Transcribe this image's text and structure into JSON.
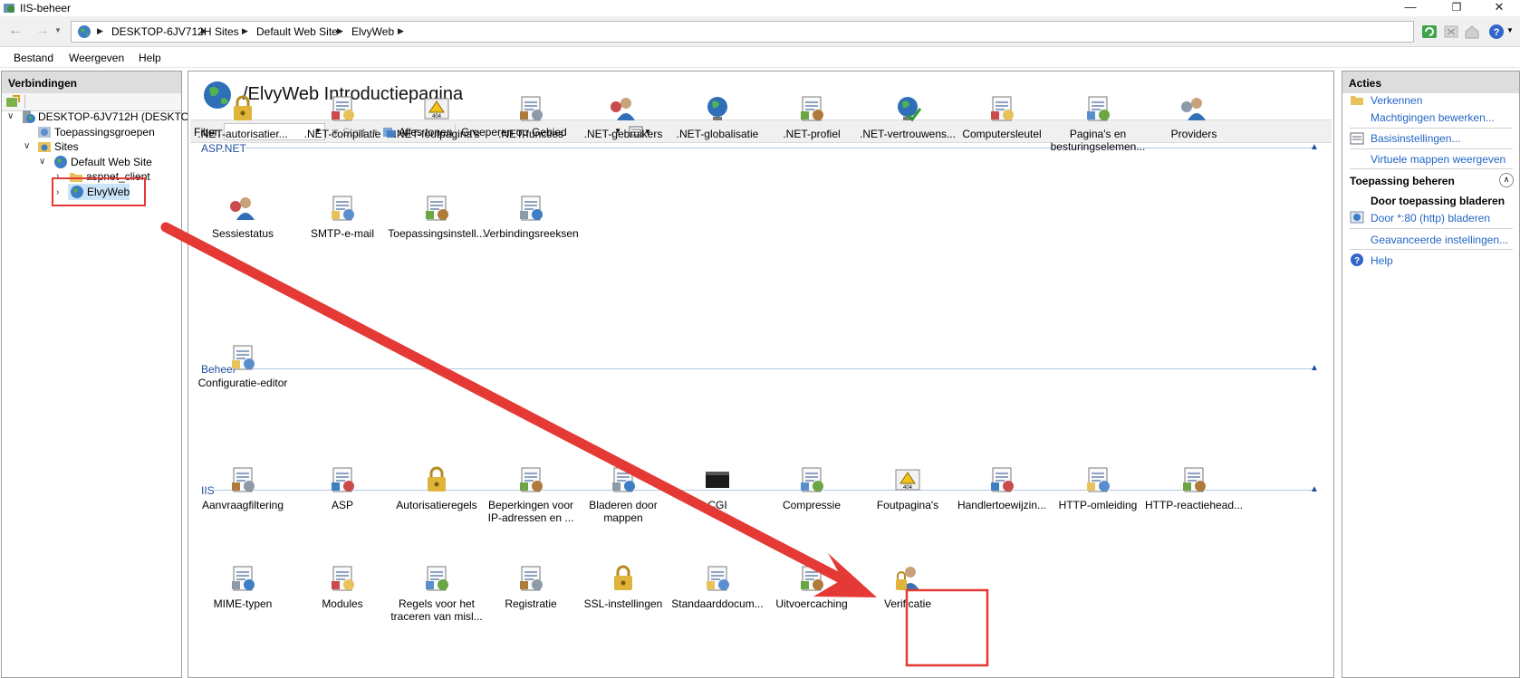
{
  "window": {
    "title": "IIS-beheer",
    "min_glyph": "—",
    "restore_glyph": "❐",
    "close_glyph": "✕"
  },
  "address": {
    "crumbs": [
      "DESKTOP-6JV712H",
      "Sites",
      "Default Web Site",
      "ElvyWeb"
    ]
  },
  "menu": [
    "Bestand",
    "Weergeven",
    "Help"
  ],
  "connections": {
    "header": "Verbindingen",
    "tree": {
      "server": "DESKTOP-6JV712H (DESKTOP-",
      "apppools": "Toepassingsgroepen",
      "sites": "Sites",
      "default_site": "Default Web Site",
      "aspnet_client": "aspnet_client",
      "elvyweb": "ElvyWeb"
    }
  },
  "main": {
    "title": "/ElvyWeb Introductiepagina",
    "filter": {
      "label": "Filter:",
      "start": "Start",
      "show_all": "Alles tonen",
      "group_label": "Groeperen op:",
      "group_value": "Gebied"
    },
    "groups": [
      {
        "name": "ASP.NET",
        "features": [
          {
            "label": ".NET-autorisatier...",
            "icon": "dotnet-authorization-icon"
          },
          {
            "label": ".NET-compilatie",
            "icon": "dotnet-compilation-icon"
          },
          {
            "label": ".NET-foutpagina's",
            "icon": "dotnet-error-pages-icon"
          },
          {
            "label": ".NET-functies",
            "icon": "dotnet-roles-icon"
          },
          {
            "label": ".NET-gebruikers",
            "icon": "dotnet-users-icon"
          },
          {
            "label": ".NET-globalisatie",
            "icon": "dotnet-globalization-icon"
          },
          {
            "label": ".NET-profiel",
            "icon": "dotnet-profile-icon"
          },
          {
            "label": ".NET-vertrouwens...",
            "icon": "dotnet-trust-icon"
          },
          {
            "label": "Computersleutel",
            "icon": "machine-key-icon"
          },
          {
            "label": "Pagina's en besturingselemen...",
            "icon": "pages-controls-icon"
          },
          {
            "label": "Providers",
            "icon": "providers-icon"
          },
          {
            "label": "Sessiestatus",
            "icon": "session-state-icon"
          },
          {
            "label": "SMTP-e-mail",
            "icon": "smtp-email-icon"
          },
          {
            "label": "Toepassingsinstell...",
            "icon": "app-settings-icon"
          },
          {
            "label": "Verbindingsreeksen",
            "icon": "connection-strings-icon"
          }
        ]
      },
      {
        "name": "Beheer",
        "features": [
          {
            "label": "Configuratie-editor",
            "icon": "configuration-editor-icon"
          }
        ]
      },
      {
        "name": "IIS",
        "features": [
          {
            "label": "Aanvraagfiltering",
            "icon": "request-filtering-icon"
          },
          {
            "label": "ASP",
            "icon": "asp-icon"
          },
          {
            "label": "Autorisatieregels",
            "icon": "authorization-rules-icon"
          },
          {
            "label": "Beperkingen voor IP-adressen en ...",
            "icon": "ip-restrictions-icon"
          },
          {
            "label": "Bladeren door mappen",
            "icon": "directory-browsing-icon"
          },
          {
            "label": "CGI",
            "icon": "cgi-icon"
          },
          {
            "label": "Compressie",
            "icon": "compression-icon"
          },
          {
            "label": "Foutpagina's",
            "icon": "error-pages-icon"
          },
          {
            "label": "Handlertoewijzin...",
            "icon": "handler-mappings-icon"
          },
          {
            "label": "HTTP-omleiding",
            "icon": "http-redirect-icon"
          },
          {
            "label": "HTTP-reactiehead...",
            "icon": "http-response-headers-icon"
          },
          {
            "label": "MIME-typen",
            "icon": "mime-types-icon"
          },
          {
            "label": "Modules",
            "icon": "modules-icon"
          },
          {
            "label": "Regels voor het traceren van misl...",
            "icon": "failed-request-tracing-icon"
          },
          {
            "label": "Registratie",
            "icon": "logging-icon"
          },
          {
            "label": "SSL-instellingen",
            "icon": "ssl-settings-icon"
          },
          {
            "label": "Standaarddocum...",
            "icon": "default-document-icon"
          },
          {
            "label": "Uitvoercaching",
            "icon": "output-caching-icon"
          },
          {
            "label": "Verificatie",
            "icon": "authentication-icon"
          }
        ]
      }
    ]
  },
  "actions": {
    "header": "Acties",
    "explore": "Verkennen",
    "edit_permissions": "Machtigingen bewerken...",
    "basic_settings": "Basisinstellingen...",
    "virtual_dirs": "Virtuele mappen weergeven",
    "manage_header": "Toepassing beheren",
    "browse_header": "Door toepassing bladeren",
    "browse_80": "Door *:80 (http) bladeren",
    "advanced": "Geavanceerde instellingen...",
    "help": "Help"
  },
  "colors": {
    "annotation_red": "#e53935",
    "link_blue": "#2266c4",
    "group_blue": "#1f4e9e"
  }
}
